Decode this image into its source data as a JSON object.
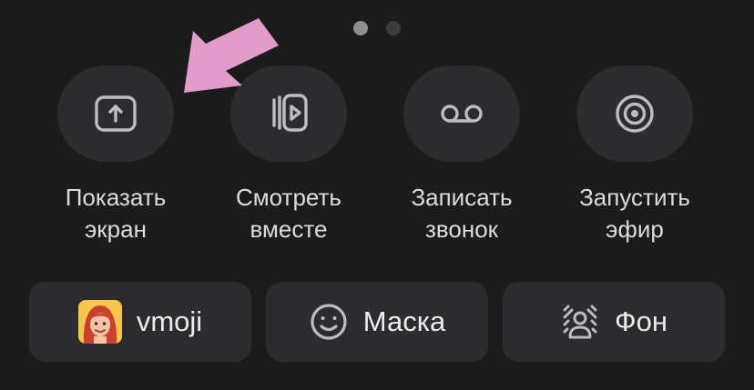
{
  "pager": {
    "pages": 2,
    "active_index": 0
  },
  "actions": [
    {
      "id": "share-screen",
      "line1": "Показать",
      "line2": "экран",
      "icon": "share-screen-icon"
    },
    {
      "id": "watch-together",
      "line1": "Смотреть",
      "line2": "вместе",
      "icon": "watch-together-icon"
    },
    {
      "id": "record-call",
      "line1": "Записать",
      "line2": "звонок",
      "icon": "voicemail-icon"
    },
    {
      "id": "start-stream",
      "line1": "Запустить",
      "line2": "эфир",
      "icon": "broadcast-icon"
    }
  ],
  "bottom": {
    "vmoji": {
      "label": "vmoji",
      "icon": "vmoji-avatar"
    },
    "mask": {
      "label": "Маска",
      "icon": "smile-icon"
    },
    "background": {
      "label": "Фон",
      "icon": "background-person-icon"
    }
  },
  "annotation": {
    "icon": "pointer-arrow-icon",
    "color": "#e19cc9"
  },
  "colors": {
    "background": "#1b1b1c",
    "button": "#2c2c2e",
    "icon": "#bdbdc0",
    "text": "#dcdcde",
    "dot_active": "#8e8e93",
    "dot_inactive": "#3c3c3e"
  }
}
